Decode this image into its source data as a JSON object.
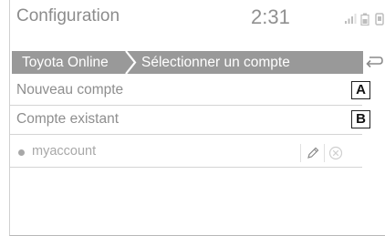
{
  "header": {
    "title": "Configuration",
    "clock": "2:31",
    "icons": [
      "signal-icon",
      "battery-icon",
      "phone-icon"
    ]
  },
  "breadcrumb": {
    "items": [
      "Toyota Online",
      "Sélectionner un compte"
    ],
    "back_icon": "back-arrow-icon"
  },
  "menu": {
    "items": [
      {
        "label": "Nouveau compte",
        "badge": "A"
      },
      {
        "label": "Compte existant",
        "badge": "B"
      }
    ]
  },
  "accounts": [
    {
      "name": "myaccount",
      "edit_icon": "pencil-icon",
      "delete_icon": "delete-circle-icon"
    }
  ],
  "colors": {
    "header_bar": "#999999",
    "text": "#8e8e8e",
    "faded_text": "#a8a8a8"
  }
}
